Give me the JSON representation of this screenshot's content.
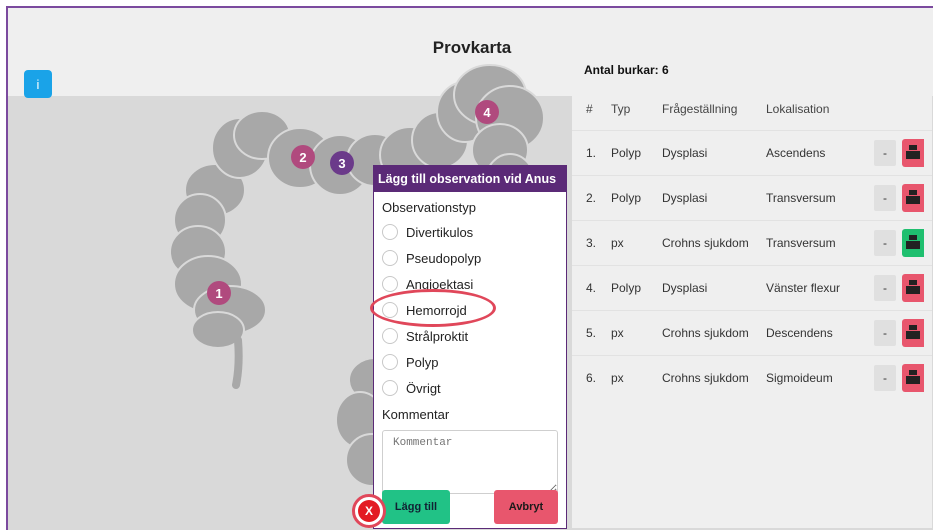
{
  "app": {
    "title": "Provkarta",
    "info_label": "i"
  },
  "markers": [
    "1",
    "2",
    "3",
    "4"
  ],
  "table": {
    "count_label": "Antal burkar: 6",
    "headers": [
      "#",
      "Typ",
      "Frågeställning",
      "Lokalisation"
    ],
    "minus_label": "-",
    "rows": [
      {
        "num": "1.",
        "typ": "Polyp",
        "fraga": "Dysplasi",
        "lok": "Ascendens",
        "print_color": "#e8566d"
      },
      {
        "num": "2.",
        "typ": "Polyp",
        "fraga": "Dysplasi",
        "lok": "Transversum",
        "print_color": "#e8566d"
      },
      {
        "num": "3.",
        "typ": "px",
        "fraga": "Crohns sjukdom",
        "lok": "Transversum",
        "print_color": "#1fbf6f"
      },
      {
        "num": "4.",
        "typ": "Polyp",
        "fraga": "Dysplasi",
        "lok": "Vänster flexur",
        "print_color": "#e8566d"
      },
      {
        "num": "5.",
        "typ": "px",
        "fraga": "Crohns sjukdom",
        "lok": "Descendens",
        "print_color": "#e8566d"
      },
      {
        "num": "6.",
        "typ": "px",
        "fraga": "Crohns sjukdom",
        "lok": "Sigmoideum",
        "print_color": "#e8566d"
      }
    ]
  },
  "modal": {
    "title": "Lägg till observation vid Anus",
    "type_label": "Observationstyp",
    "options": [
      "Divertikulos",
      "Pseudopolyp",
      "Angioektasi",
      "Hemorrojd",
      "Strålproktit",
      "Polyp",
      "Övrigt"
    ],
    "comment_label": "Kommentar",
    "comment_placeholder": "Kommentar",
    "add_label": "Lägg till",
    "cancel_label": "Avbryt"
  },
  "close_label": "X",
  "colors": {
    "accent": "#5b2a77",
    "info": "#1aa3e8",
    "add": "#21c286",
    "cancel": "#e8566d",
    "highlight": "#e0475a",
    "marker": "#b04a7e"
  }
}
